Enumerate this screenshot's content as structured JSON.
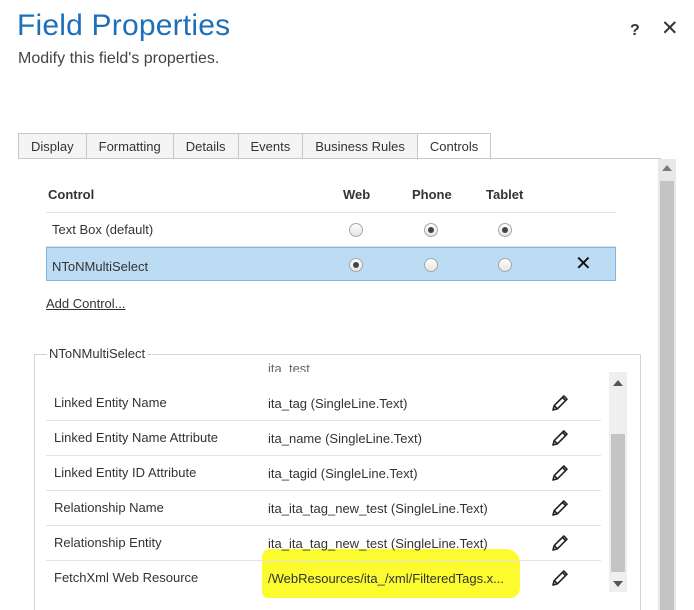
{
  "dialog": {
    "title": "Field Properties",
    "subtitle": "Modify this field's properties.",
    "help_label": "?",
    "close_label": "✕"
  },
  "tabs": [
    {
      "label": "Display",
      "active": false
    },
    {
      "label": "Formatting",
      "active": false
    },
    {
      "label": "Details",
      "active": false
    },
    {
      "label": "Events",
      "active": false
    },
    {
      "label": "Business Rules",
      "active": false
    },
    {
      "label": "Controls",
      "active": true
    }
  ],
  "controls_table": {
    "headers": {
      "control": "Control",
      "web": "Web",
      "phone": "Phone",
      "tablet": "Tablet"
    },
    "rows": [
      {
        "name": "Text Box (default)",
        "web": false,
        "phone": true,
        "tablet": true,
        "selected": false
      },
      {
        "name": "NToNMultiSelect",
        "web": true,
        "phone": false,
        "tablet": false,
        "selected": true
      }
    ],
    "remove_label": "✕",
    "add_control_label": "Add Control..."
  },
  "properties": {
    "group_title": "NToNMultiSelect",
    "clipped_value": "ita_test",
    "rows": [
      {
        "label": "Linked Entity Name",
        "value": "ita_tag (SingleLine.Text)"
      },
      {
        "label": "Linked Entity Name Attribute",
        "value": "ita_name (SingleLine.Text)"
      },
      {
        "label": "Linked Entity ID Attribute",
        "value": "ita_tagid (SingleLine.Text)"
      },
      {
        "label": "Relationship Name",
        "value": "ita_ita_tag_new_test (SingleLine.Text)"
      },
      {
        "label": "Relationship Entity",
        "value": "ita_ita_tag_new_test (SingleLine.Text)"
      },
      {
        "label": "FetchXml Web Resource",
        "value": "/WebResources/ita_/xml/FilteredTags.x..."
      }
    ],
    "highlight_color": "#fbfb30"
  },
  "colors": {
    "title_blue": "#1e6fb8",
    "selected_row": "#bcdcf3"
  }
}
